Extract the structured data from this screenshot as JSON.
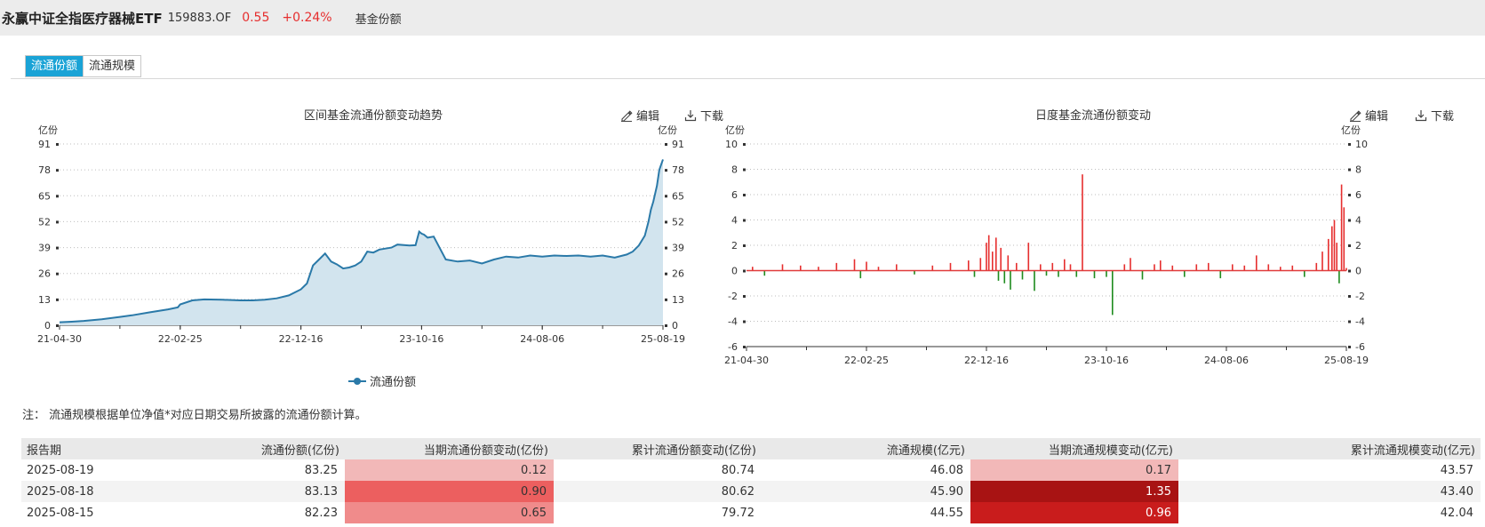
{
  "header": {
    "fund_name": "永赢中证全指医疗器械ETF",
    "fund_code": "159883.OF",
    "price": "0.55",
    "change": "+0.24%",
    "link": "基金份额"
  },
  "tabs": [
    {
      "label": "流通份额",
      "active": true
    },
    {
      "label": "流通规模",
      "active": false
    }
  ],
  "toolbar": {
    "edit": "编辑",
    "download": "下载"
  },
  "colors": {
    "accent": "#1aa3d6",
    "up": "#e62e2e",
    "down": "#1e8c1e",
    "line": "#2a79a8",
    "area": "#d2e4ee"
  },
  "chart_data": [
    {
      "type": "area",
      "title": "区间基金流通份额变动趋势",
      "ylabel_left": "亿份",
      "ylabel_right": "亿份",
      "yticks": [
        0,
        13,
        26,
        39,
        52,
        65,
        78,
        91
      ],
      "ylim": [
        0,
        91
      ],
      "xticks": [
        "21-04-30",
        "22-02-25",
        "22-12-16",
        "23-10-16",
        "24-08-06",
        "25-08-19"
      ],
      "legend": "流通份额",
      "x": [
        0,
        0.1,
        0.2,
        0.35,
        0.5,
        0.6,
        0.75,
        0.9,
        0.98,
        1.0,
        1.1,
        1.2,
        1.35,
        1.5,
        1.6,
        1.7,
        1.8,
        1.9,
        2.0,
        2.05,
        2.1,
        2.15,
        2.2,
        2.25,
        2.3,
        2.35,
        2.4,
        2.45,
        2.5,
        2.55,
        2.6,
        2.65,
        2.7,
        2.75,
        2.8,
        2.9,
        2.95,
        2.98,
        3.0,
        3.02,
        3.05,
        3.1,
        3.2,
        3.3,
        3.4,
        3.5,
        3.6,
        3.7,
        3.8,
        3.9,
        4.0,
        4.1,
        4.2,
        4.3,
        4.4,
        4.5,
        4.6,
        4.7,
        4.75,
        4.8,
        4.85,
        4.88,
        4.9,
        4.92,
        4.95,
        4.97,
        5.0
      ],
      "values": [
        1.5,
        1.8,
        2.2,
        3.0,
        4.2,
        5.0,
        6.5,
        8.0,
        9.0,
        10.5,
        12.5,
        13.0,
        12.8,
        12.5,
        12.5,
        12.8,
        13.5,
        15.0,
        18.0,
        21.0,
        30.0,
        33.0,
        36.0,
        32.0,
        30.5,
        28.5,
        29.0,
        30.0,
        32.0,
        37.0,
        36.5,
        38.0,
        38.5,
        39.0,
        40.5,
        40.0,
        40.2,
        47.0,
        46.0,
        45.5,
        44.0,
        44.5,
        33.0,
        32.0,
        32.5,
        31.0,
        33.0,
        34.5,
        34.0,
        35.0,
        34.5,
        35.0,
        34.8,
        35.0,
        34.5,
        35.0,
        34.0,
        35.5,
        37.0,
        40.0,
        45.0,
        52.0,
        58.0,
        62.0,
        70.0,
        78.0,
        83.25
      ]
    },
    {
      "type": "bar",
      "title": "日度基金流通份额变动",
      "ylabel_left": "亿份",
      "ylabel_right": "亿份",
      "yticks": [
        -6,
        -4,
        -2,
        0,
        2,
        4,
        6,
        8,
        10
      ],
      "ylim": [
        -6,
        10
      ],
      "xticks": [
        "21-04-30",
        "22-02-25",
        "22-12-16",
        "23-10-16",
        "24-08-06",
        "25-08-19"
      ],
      "x": [
        0.05,
        0.15,
        0.3,
        0.45,
        0.6,
        0.75,
        0.9,
        0.95,
        1.0,
        1.1,
        1.25,
        1.4,
        1.55,
        1.7,
        1.85,
        1.9,
        1.95,
        2.0,
        2.02,
        2.05,
        2.08,
        2.1,
        2.12,
        2.15,
        2.18,
        2.2,
        2.25,
        2.3,
        2.35,
        2.4,
        2.45,
        2.5,
        2.55,
        2.6,
        2.65,
        2.7,
        2.75,
        2.8,
        2.9,
        3.0,
        3.05,
        3.15,
        3.2,
        3.3,
        3.4,
        3.45,
        3.55,
        3.65,
        3.75,
        3.85,
        3.95,
        4.05,
        4.15,
        4.25,
        4.35,
        4.45,
        4.55,
        4.65,
        4.75,
        4.8,
        4.85,
        4.88,
        4.9,
        4.92,
        4.94,
        4.96,
        4.98,
        5.0
      ],
      "values": [
        0.3,
        -0.4,
        0.5,
        0.4,
        0.3,
        0.6,
        0.9,
        -0.6,
        0.7,
        0.3,
        0.5,
        -0.3,
        0.4,
        0.6,
        0.8,
        -0.5,
        1.0,
        2.2,
        2.8,
        1.5,
        2.6,
        -0.8,
        1.8,
        -1.0,
        1.2,
        -1.5,
        0.6,
        -0.7,
        2.2,
        -1.6,
        0.5,
        -0.4,
        0.6,
        -0.5,
        0.9,
        0.5,
        -0.5,
        7.6,
        -0.6,
        -0.5,
        -3.5,
        0.5,
        1.0,
        -0.7,
        0.5,
        0.8,
        0.4,
        -0.5,
        0.5,
        0.6,
        -0.6,
        0.5,
        0.4,
        1.2,
        0.5,
        0.3,
        0.4,
        -0.5,
        0.6,
        1.5,
        2.5,
        3.5,
        4.0,
        2.2,
        -1.0,
        6.8,
        5.0,
        0.2
      ]
    }
  ],
  "note": "注：  流通规模根据单位净值*对应日期交易所披露的流通份额计算。",
  "table": {
    "headers": [
      "报告期",
      "流通份额(亿份)",
      "当期流通份额变动(亿份)",
      "累计流通份额变动(亿份)",
      "流通规模(亿元)",
      "当期流通规模变动(亿元)",
      "累计流通规模变动(亿元)"
    ],
    "rows": [
      {
        "date": "2025-08-19",
        "shares": "83.25",
        "share_change": "0.12",
        "cum_share_change": "80.74",
        "scale": "46.08",
        "scale_change": "0.17",
        "cum_scale_change": "43.57",
        "share_color": "#f2b8b8",
        "scale_color": "#f2b8b8",
        "share_text": "#333333",
        "scale_text": "#333333"
      },
      {
        "date": "2025-08-18",
        "shares": "83.13",
        "share_change": "0.90",
        "cum_share_change": "80.62",
        "scale": "45.90",
        "scale_change": "1.35",
        "cum_scale_change": "43.40",
        "share_color": "#ec5f5f",
        "scale_color": "#a81313",
        "share_text": "#333333",
        "scale_text": "#ffffff"
      },
      {
        "date": "2025-08-15",
        "shares": "82.23",
        "share_change": "0.65",
        "cum_share_change": "79.72",
        "scale": "44.55",
        "scale_change": "0.96",
        "cum_scale_change": "42.04",
        "share_color": "#f08b8b",
        "scale_color": "#c91c1c",
        "share_text": "#333333",
        "scale_text": "#ffffff"
      }
    ]
  }
}
